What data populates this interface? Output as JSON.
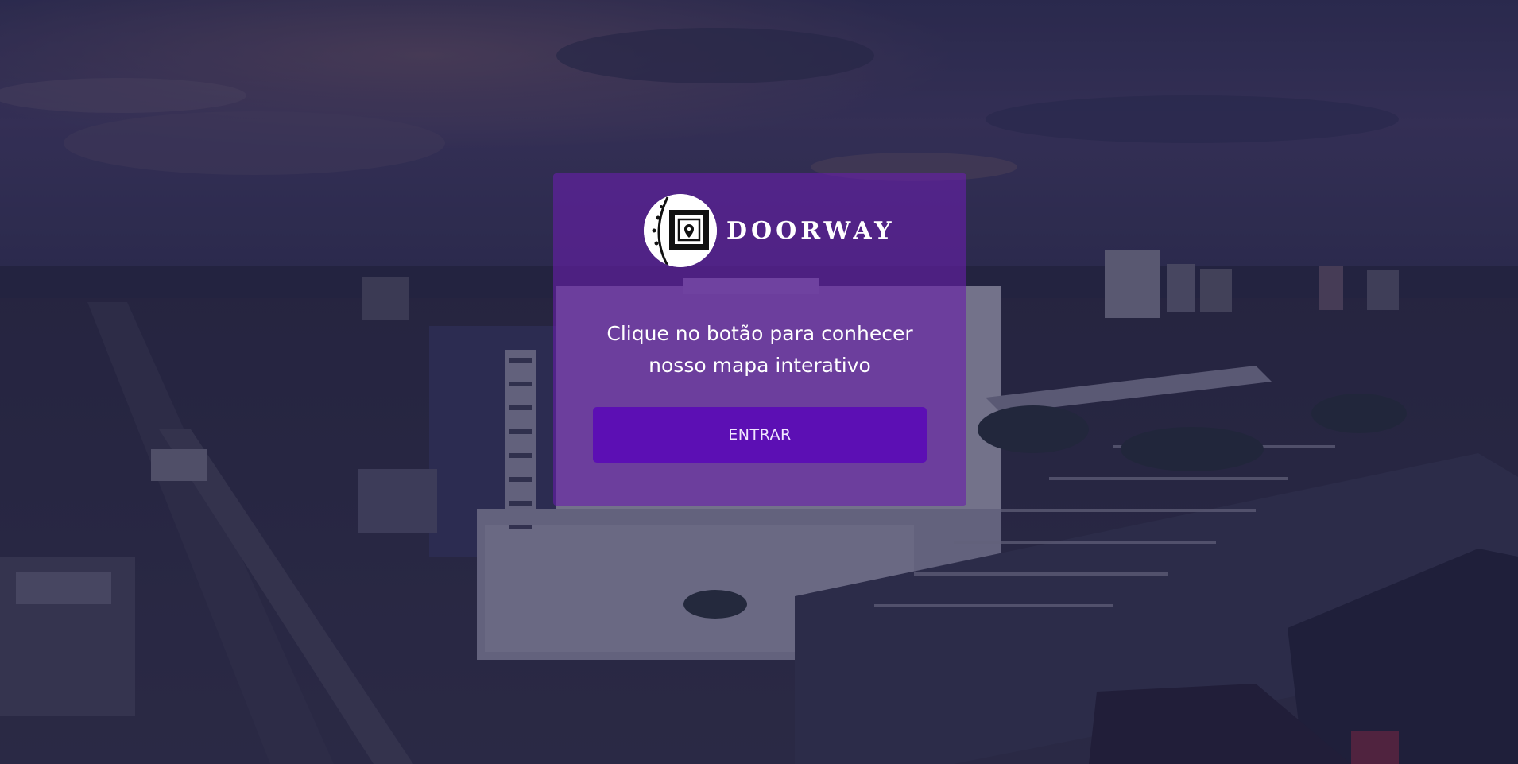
{
  "brand": {
    "name": "DOORWAY",
    "logo_icon": "doorway-logo-icon"
  },
  "modal": {
    "message_line1": "Clique no botão para conhecer",
    "message_line2": "nosso mapa interativo",
    "enter_button_label": "ENTRAR"
  },
  "colors": {
    "card_background": "#681eaa",
    "button_background": "#5c0fb4",
    "text": "#ffffff"
  }
}
